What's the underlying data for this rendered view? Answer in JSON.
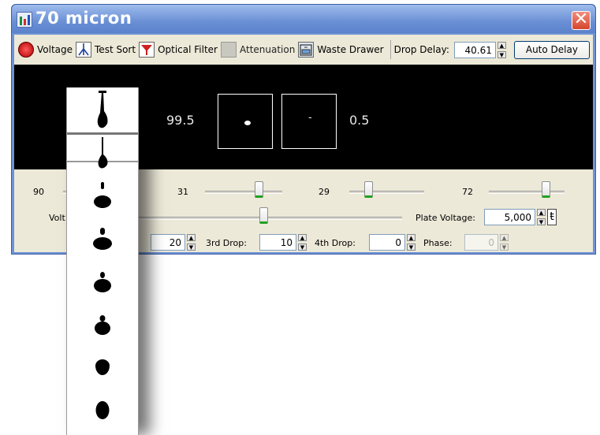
{
  "window": {
    "title": "70 micron",
    "close_glyph": "✕"
  },
  "toolbar": {
    "voltage_label": "Voltage",
    "test_sort_label": "Test Sort",
    "optical_filter_label": "Optical Filter",
    "attenuation_label": "Attenuation",
    "waste_drawer_label": "Waste Drawer",
    "drop_delay_label": "Drop Delay:",
    "drop_delay_value": "40.61",
    "auto_delay_label": "Auto Delay"
  },
  "camera": {
    "left_readout": "99.5",
    "center_box_glyph": "-",
    "right_readout": "0.5"
  },
  "sliders": {
    "amplitude_value": "90",
    "frequency_value": "31",
    "drop1_value": "29",
    "gap_value": "72"
  },
  "voltage_row": {
    "voltage_label": "Volt",
    "plate_voltage_label": "Plate Voltage:",
    "plate_voltage_value": "5,000"
  },
  "drop_row": {
    "second_drop_value": "20",
    "third_drop_label": "3rd Drop:",
    "third_drop_value": "10",
    "fourth_drop_label": "4th Drop:",
    "fourth_drop_value": "0",
    "phase_label": "Phase:",
    "phase_value": "0"
  },
  "icons": {
    "voltage": "red-power-icon",
    "test_sort": "stream-icon",
    "optical_filter": "filter-icon",
    "attenuation": "attenuation-icon",
    "waste_drawer": "drawer-icon"
  }
}
